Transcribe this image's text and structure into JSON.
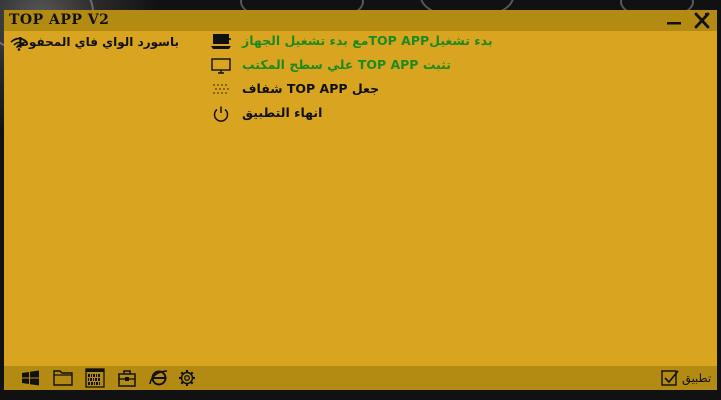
{
  "window": {
    "title": "TOP APP V2",
    "minimize_icon": "minimize-icon",
    "close_icon": "close-icon"
  },
  "wifi": {
    "icon": "wifi-icon",
    "label": "باسورد الواي فاي المحفوظ"
  },
  "options": [
    {
      "icon": "computer-startup-icon",
      "label": "بدء تشغيلTOP APPمع بدء تشغيل الجهاز",
      "color": "#1e8a1e"
    },
    {
      "icon": "monitor-icon",
      "label": "تثبت TOP APP علي سطح المكتب",
      "color": "#1e8a1e"
    },
    {
      "icon": "transparency-icon",
      "label": "جعل TOP APP شفاف",
      "color": "#111111"
    },
    {
      "icon": "power-icon",
      "label": "انهاء التطبيق",
      "color": "#111111"
    }
  ],
  "taskbar": {
    "icons": [
      "windows-icon",
      "folder-icon",
      "binary-file-icon",
      "toolbox-icon",
      "internet-explorer-icon",
      "gear-icon"
    ],
    "apply_label": "تطبيق",
    "apply_icon": "checkbox-icon"
  },
  "colors": {
    "body": "#d9a520",
    "bars": "#b38a12",
    "green_text": "#1e8a1e"
  }
}
